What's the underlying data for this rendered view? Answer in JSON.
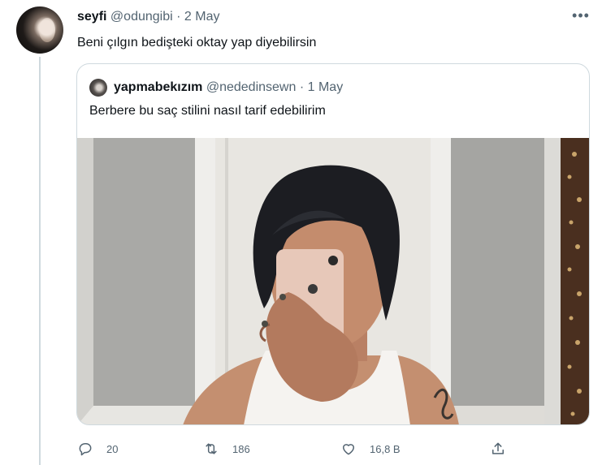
{
  "tweet": {
    "author_name": "seyfi",
    "handle": "@odungibi",
    "separator": "·",
    "date": "2 May",
    "text": "Beni çılgın bedişteki oktay yap diyebilirsin",
    "more_icon": "more-dots-icon"
  },
  "quote": {
    "author_name": "yapmabekızım",
    "handle": "@nededinsewn",
    "separator": "·",
    "date": "1 May",
    "text": "Berbere bu saç stilini nasıl tarif edebilirim"
  },
  "actions": {
    "reply_count": "20",
    "retweet_count": "186",
    "like_count": "16,8 B"
  },
  "icons": [
    "reply-icon",
    "retweet-icon",
    "like-icon",
    "share-icon"
  ],
  "colors": {
    "text": "#0f1419",
    "muted": "#536471",
    "border": "#cfd9de"
  }
}
